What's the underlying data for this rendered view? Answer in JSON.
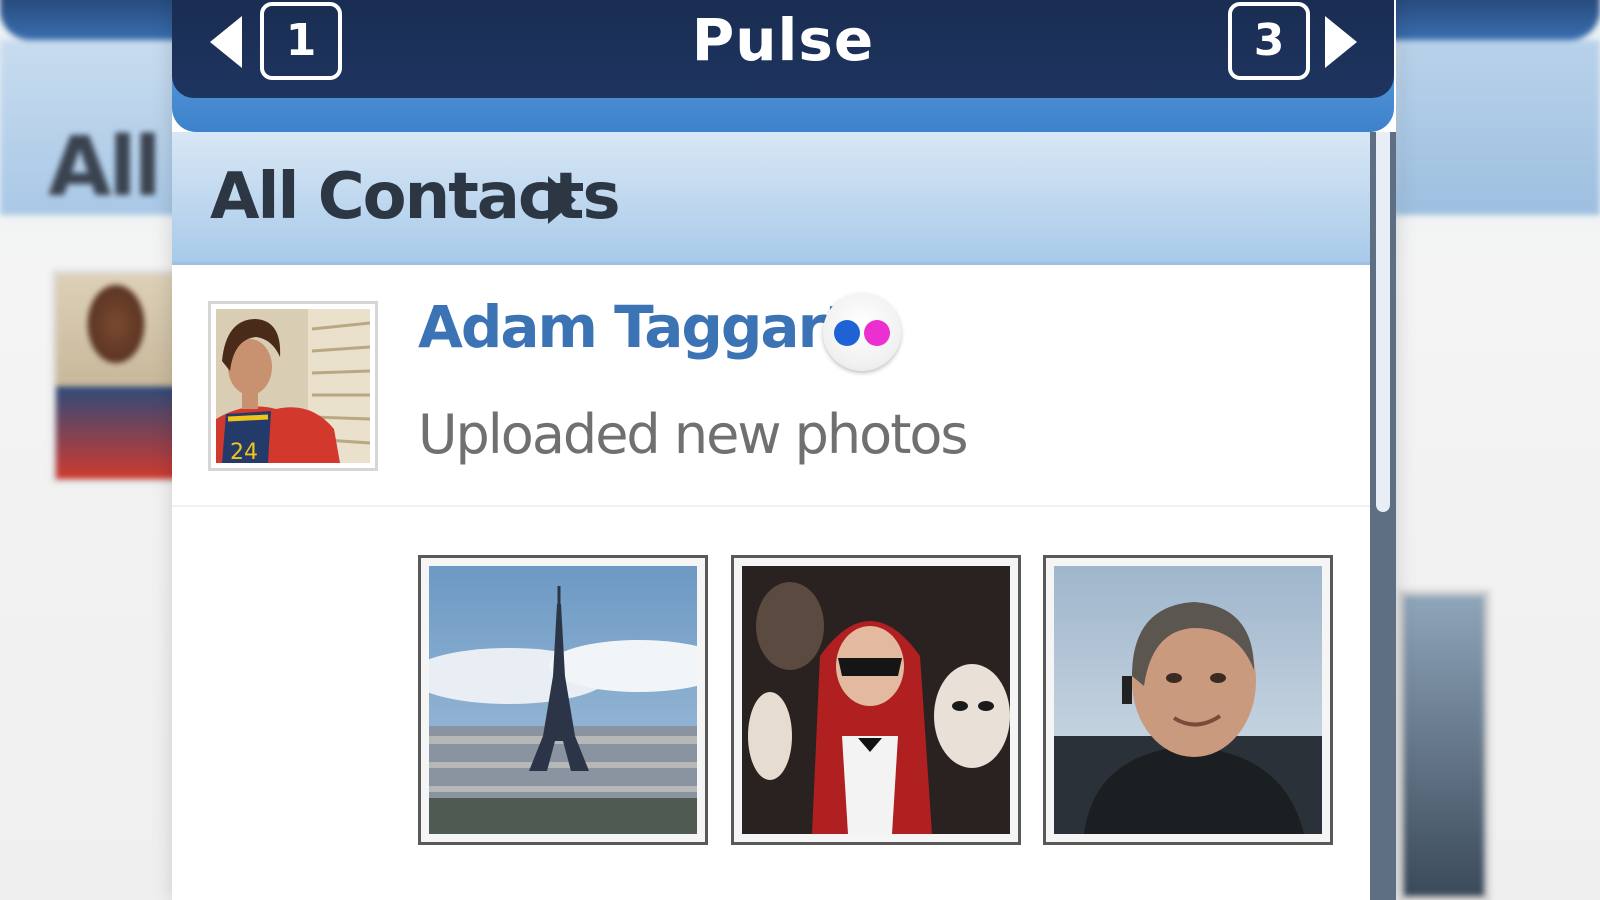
{
  "app": {
    "title": "Pulse",
    "prev_page": "1",
    "next_page": "3"
  },
  "filter": {
    "label": "All Contacts"
  },
  "feed": {
    "items": [
      {
        "name": "Adam Taggart",
        "service_icon": "flickr-icon",
        "status": "Uploaded new photos",
        "photos": [
          {
            "icon": "eiffel-tower-photo"
          },
          {
            "icon": "masquerade-costume-photo"
          },
          {
            "icon": "man-portrait-photo"
          }
        ]
      }
    ]
  },
  "background": {
    "blurred_label": "All C"
  },
  "colors": {
    "titlebar": "#1e3560",
    "accent_blue": "#3d82cc",
    "name": "#3b73b5",
    "flickr_blue": "#1f62d6",
    "flickr_pink": "#ec2fd1"
  }
}
